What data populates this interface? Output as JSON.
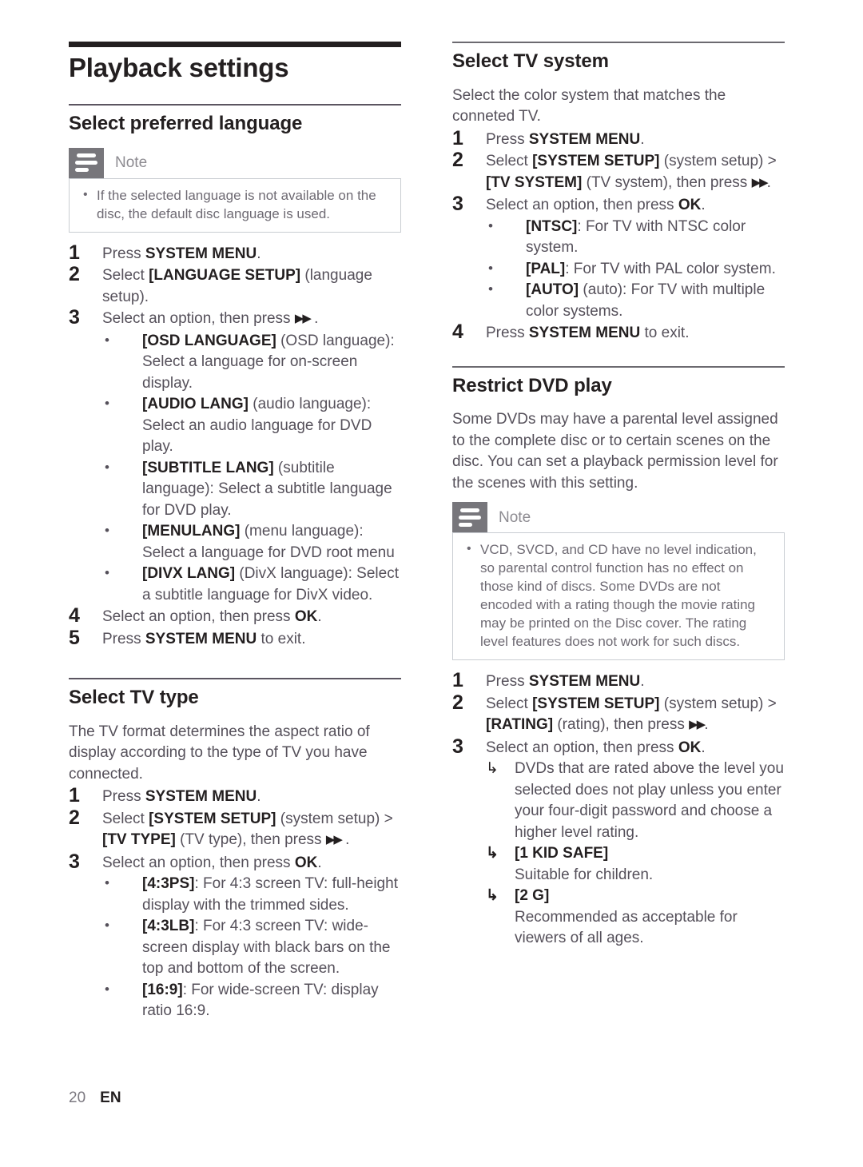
{
  "document": {
    "page_title": "Playback settings",
    "footer": {
      "page_number": "20",
      "language_code": "EN"
    },
    "note_label": "Note",
    "ff_symbol": "▶▶",
    "arrow_symbol": "↳"
  },
  "left_column": {
    "sections": [
      {
        "title": "Select preferred language",
        "note": {
          "label": "Note",
          "items": [
            "If the selected language is not available on the disc, the default disc language is used."
          ]
        },
        "steps": [
          {
            "num": "1",
            "text_html": "Press <b>SYSTEM MENU</b>."
          },
          {
            "num": "2",
            "text_html": "Select <b>[LANGUAGE SETUP]</b> (language setup)."
          },
          {
            "num": "3",
            "text_html": "Select an option, then press <span class=\"ff\">▶▶</span> ."
          }
        ],
        "bullets": [
          "<b>[OSD LANGUAGE]</b> (OSD language): Select a language for on-screen display.",
          "<b>[AUDIO LANG]</b> (audio language): Select an audio language for DVD play.",
          "<b>[SUBTITLE LANG]</b> (subtitile language): Select a subtitle language for DVD play.",
          "<b>[MENULANG]</b> (menu language): Select a language for DVD root menu",
          "<b>[DIVX LANG]</b> (DivX language): Select a subtitle language for DivX video."
        ],
        "steps_after": [
          {
            "num": "4",
            "text_html": "Select an option, then press <b>OK</b>."
          },
          {
            "num": "5",
            "text_html": "Press <b>SYSTEM MENU</b> to exit."
          }
        ]
      },
      {
        "title": "Select TV type",
        "intro": "The TV format determines the aspect ratio of display according to the type of TV you have connected.",
        "steps": [
          {
            "num": "1",
            "text_html": "Press <b>SYSTEM MENU</b>."
          },
          {
            "num": "2",
            "text_html": "Select <b>[SYSTEM SETUP]</b> (system setup) &gt; <b>[TV TYPE]</b> (TV type), then press <span class=\"ff\">▶▶</span> ."
          },
          {
            "num": "3",
            "text_html": "Select an option, then press <b>OK</b>."
          }
        ],
        "bullets": [
          "<b>[4:3PS]</b>: For 4:3 screen TV: full-height display with the trimmed sides.",
          "<b>[4:3LB]</b>: For 4:3 screen TV: wide-screen display with black bars on the top and bottom of the screen.",
          "<b>[16:9]</b>: For wide-screen TV: display ratio 16:9."
        ]
      }
    ]
  },
  "right_column": {
    "sections": [
      {
        "title": "Select TV system",
        "intro": "Select the color system that matches the conneted TV.",
        "steps": [
          {
            "num": "1",
            "text_html": "Press <b>SYSTEM MENU</b>."
          },
          {
            "num": "2",
            "text_html": "Select <b>[SYSTEM SETUP]</b> (system setup) &gt; <b>[TV SYSTEM]</b> (TV system), then press <span class=\"ff\">▶▶</span>."
          },
          {
            "num": "3",
            "text_html": "Select an option, then press <b>OK</b>."
          }
        ],
        "bullets": [
          "<b>[NTSC]</b>: For TV with NTSC color system.",
          "<b>[PAL]</b>: For TV with PAL color system.",
          "<b>[AUTO]</b> (auto): For TV with multiple color systems."
        ],
        "steps_after": [
          {
            "num": "4",
            "text_html": "Press <b>SYSTEM MENU</b> to exit."
          }
        ]
      },
      {
        "title": "Restrict DVD play",
        "intro": "Some DVDs may have a parental level assigned to the complete disc or to certain scenes on the disc. You can set a playback permission level for the scenes with this setting.",
        "note": {
          "label": "Note",
          "items": [
            "VCD, SVCD, and CD have no level indication, so parental control function has no effect on those kind of discs. Some DVDs are not encoded with a rating though the movie rating may be printed on the Disc cover. The rating level features does not work for such discs."
          ]
        },
        "steps": [
          {
            "num": "1",
            "text_html": "Press <b>SYSTEM MENU</b>."
          },
          {
            "num": "2",
            "text_html": "Select <b>[SYSTEM SETUP]</b> (system setup) &gt; <b>[RATING]</b> (rating), then press <span class=\"ff\">▶▶</span>."
          },
          {
            "num": "3",
            "text_html": "Select an option, then press <b>OK</b>."
          }
        ],
        "arrow_items": [
          {
            "kind": "text",
            "text": "DVDs that are rated above the level you selected does not play unless you enter your four-digit password and choose a higher level rating."
          },
          {
            "kind": "level",
            "text": "[1 KID SAFE]"
          },
          {
            "kind": "desc",
            "text": "Suitable for children."
          },
          {
            "kind": "level",
            "text": "[2 G]"
          },
          {
            "kind": "desc",
            "text": "Recommended as acceptable for viewers of all ages."
          }
        ]
      }
    ]
  }
}
